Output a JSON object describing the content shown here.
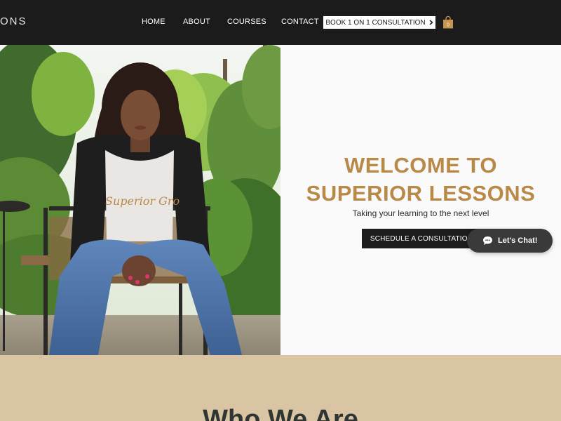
{
  "header": {
    "logo_text": "ONS",
    "nav": {
      "home": "HOME",
      "about": "ABOUT",
      "courses": "COURSES",
      "contact": "CONTACT"
    },
    "cta_label": "BOOK 1 ON 1 CONSULTATION",
    "cart_count": "0"
  },
  "hero": {
    "title_line1": "WELCOME TO",
    "title_line2": "SUPERIOR LESSONS",
    "tagline": "Taking your learning to the next level",
    "cta_label": "SCHEDULE A CONSULTATION",
    "shirt_text": "Superior Gro"
  },
  "chat": {
    "label": "Let's Chat!"
  },
  "section": {
    "title": "Who We Are"
  },
  "colors": {
    "header_bg": "#1b1b1b",
    "accent_gold": "#b98948",
    "section_bg": "#d9c4a3",
    "button_dark": "#1d1d1d"
  }
}
